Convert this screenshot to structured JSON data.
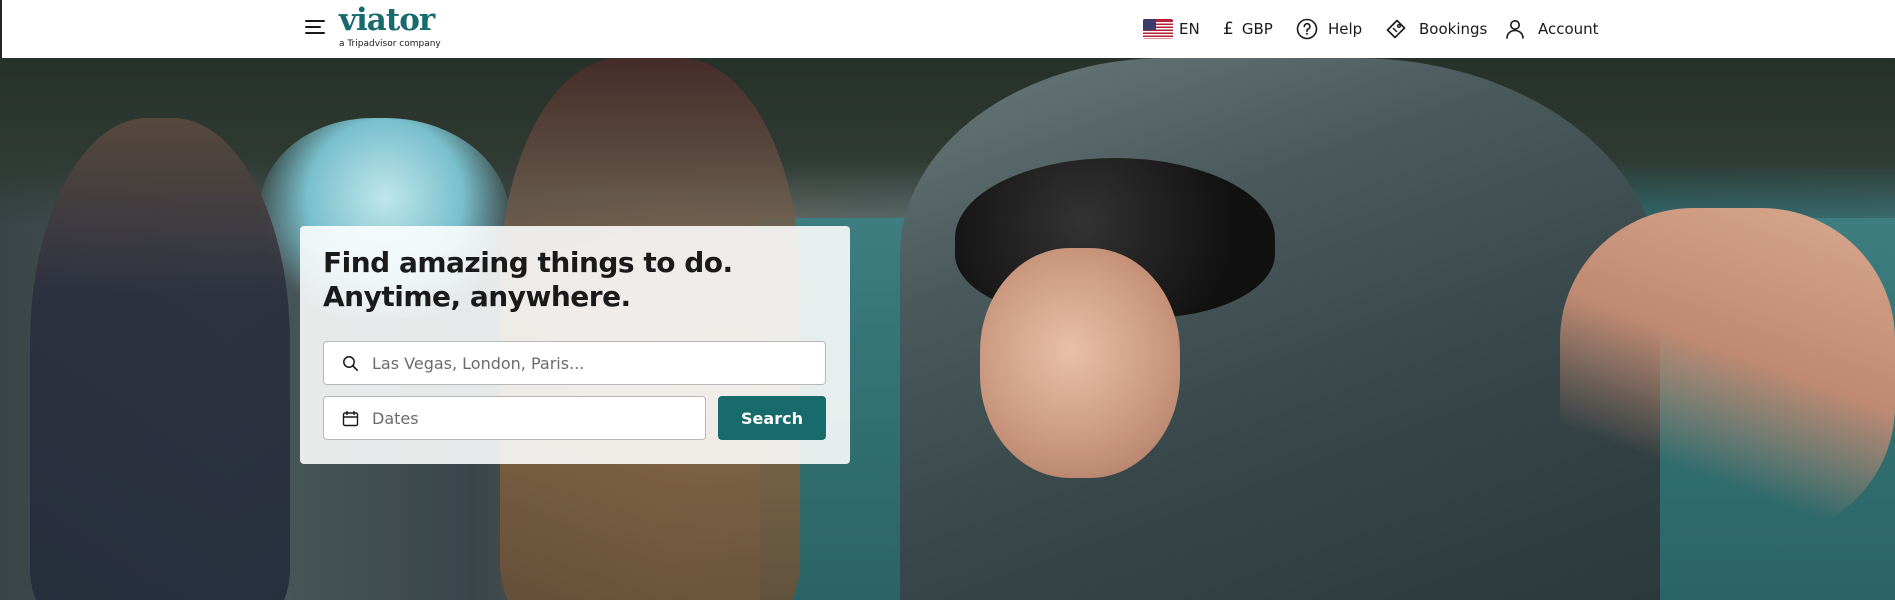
{
  "header": {
    "logo": {
      "wordmark": "viator",
      "tagline": "a Tripadvisor company",
      "color": "#186b6d"
    },
    "nav": {
      "language": {
        "code": "EN",
        "flag_icon": "us-flag-icon"
      },
      "currency": {
        "symbol": "£",
        "code": "GBP"
      },
      "help": {
        "label": "Help",
        "icon": "help-circle-icon"
      },
      "bookings": {
        "label": "Bookings",
        "icon": "ticket-tag-icon"
      },
      "account": {
        "label": "Account",
        "icon": "user-icon"
      }
    }
  },
  "hero": {
    "title_line1": "Find amazing things to do.",
    "title_line2": "Anytime, anywhere.",
    "search": {
      "destination_placeholder": "Las Vegas, London, Paris...",
      "dates_placeholder": "Dates",
      "button_label": "Search",
      "button_color": "#186b6d"
    }
  }
}
